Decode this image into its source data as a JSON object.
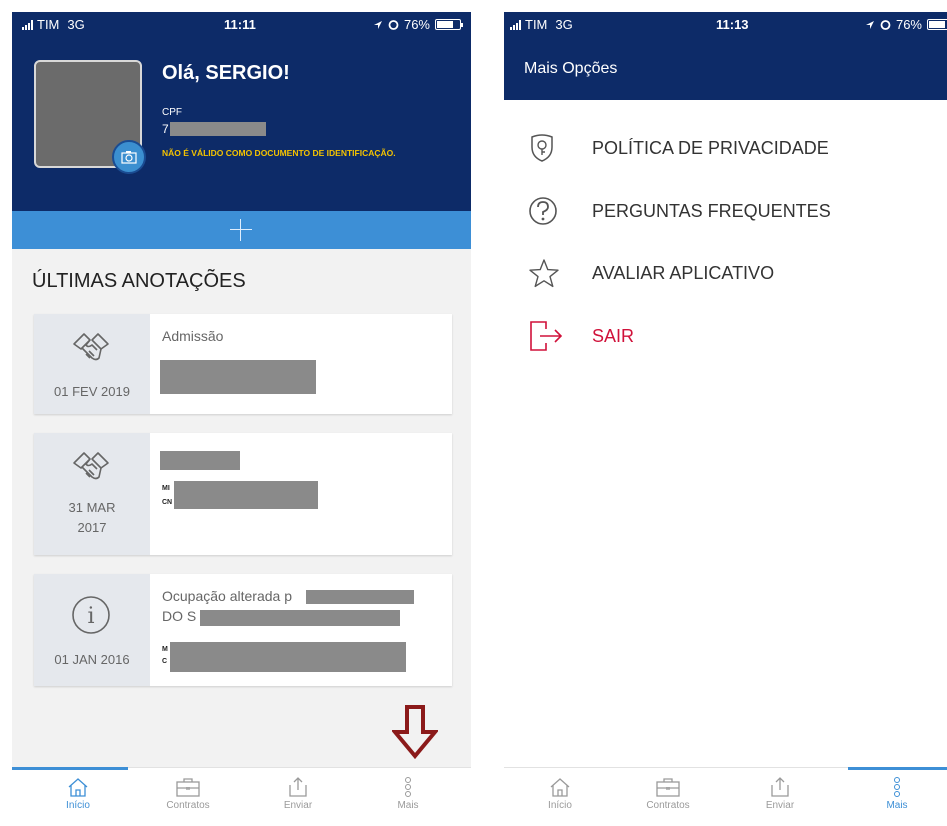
{
  "left_screen": {
    "status": {
      "carrier": "TIM",
      "network": "3G",
      "time": "11:11",
      "battery": "76%",
      "battery_level": 0.76
    },
    "greeting": "Olá, SERGIO!",
    "cpf_label": "CPF",
    "cpf_value": "7",
    "id_warning": "NÃO É VÁLIDO COMO DOCUMENTO DE IDENTIFICAÇÃO.",
    "section_title": "ÚLTIMAS ANOTAÇÕES",
    "annotations": [
      {
        "icon": "handshake-icon",
        "date": "01 FEV 2019",
        "title": "Admissão"
      },
      {
        "icon": "handshake-icon",
        "date_line1": "31 MAR",
        "date_line2": "2017",
        "tiny1": "MI",
        "tiny2": "CN"
      },
      {
        "icon": "info-icon",
        "date": "01 JAN 2016",
        "title_line1": "Ocupação alterada p",
        "title_line2": "DO S",
        "tiny1": "M",
        "tiny2": "C"
      }
    ],
    "tabs": [
      {
        "label": "Início",
        "icon": "home-icon",
        "active": true
      },
      {
        "label": "Contratos",
        "icon": "briefcase-icon",
        "active": false
      },
      {
        "label": "Enviar",
        "icon": "upload-icon",
        "active": false
      },
      {
        "label": "Mais",
        "icon": "more-icon",
        "active": false
      }
    ]
  },
  "right_screen": {
    "status": {
      "carrier": "TIM",
      "network": "3G",
      "time": "11:13",
      "battery": "76%",
      "battery_level": 0.76
    },
    "title": "Mais Opções",
    "menu": [
      {
        "label": "POLÍTICA DE PRIVACIDADE",
        "icon": "shield-lock-icon"
      },
      {
        "label": "PERGUNTAS FREQUENTES",
        "icon": "question-icon"
      },
      {
        "label": "AVALIAR APLICATIVO",
        "icon": "star-icon"
      },
      {
        "label": "SAIR",
        "icon": "logout-icon",
        "color": "#d0113a"
      }
    ],
    "tabs": [
      {
        "label": "Início",
        "icon": "home-icon",
        "active": false
      },
      {
        "label": "Contratos",
        "icon": "briefcase-icon",
        "active": false
      },
      {
        "label": "Enviar",
        "icon": "upload-icon",
        "active": false
      },
      {
        "label": "Mais",
        "icon": "more-icon",
        "active": true
      }
    ]
  },
  "colors": {
    "header_blue": "#0d2b68",
    "accent_blue": "#3d8fd6",
    "warning_yellow": "#f4c300",
    "danger_red": "#d0113a",
    "arrow_red": "#8b1a1a"
  }
}
